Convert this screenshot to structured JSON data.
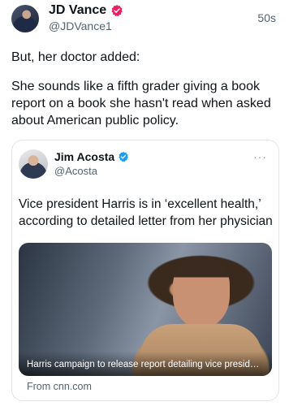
{
  "post": {
    "author_name": "JD Vance",
    "author_handle": "@JDVance1",
    "time": "50s",
    "text_1": "But, her doctor added:",
    "text_2": "She sounds like a fifth grader giving a book report on a book she hasn't read when asked about American public policy."
  },
  "quote": {
    "author_name": "Jim Acosta",
    "author_handle": "@Acosta",
    "more_label": "···",
    "text": "Vice president Harris is in ‘excellent health,’ according to detailed letter from her physician",
    "link": {
      "title": "Harris campaign to release report detailing vice president's…",
      "source": "From cnn.com"
    }
  },
  "colors": {
    "verified_gold": "#e0245e",
    "verified_blue": "#1d9bf0"
  },
  "icons": {
    "verified_main": "verified-badge-icon",
    "verified_quote": "verified-badge-icon"
  }
}
